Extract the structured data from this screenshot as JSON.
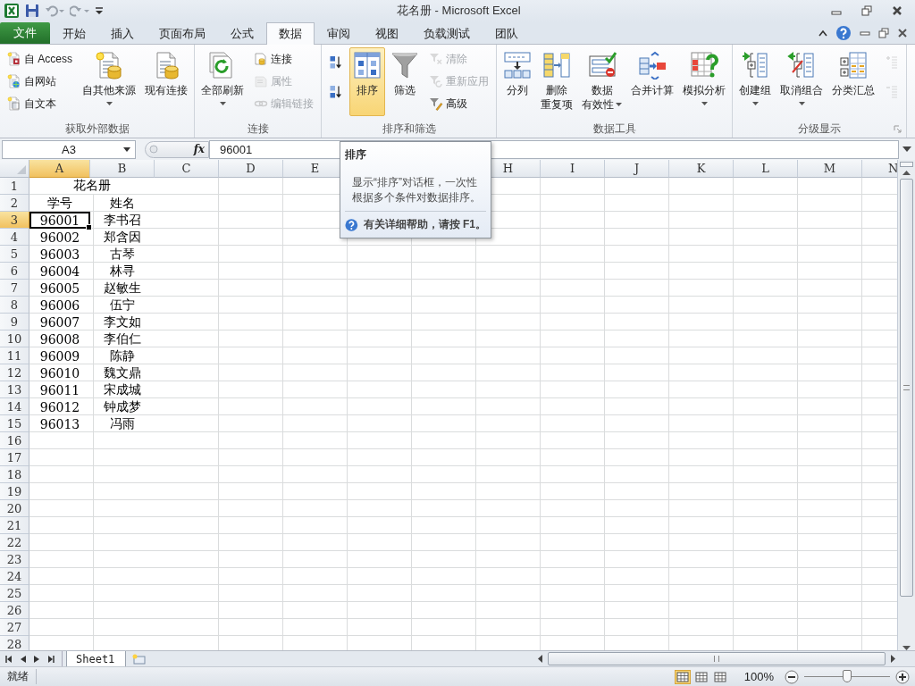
{
  "window": {
    "title": "花名册 - Microsoft Excel"
  },
  "tabs": [
    {
      "label": "文件",
      "kind": "file",
      "selected": false
    },
    {
      "label": "开始",
      "kind": "tab",
      "selected": false
    },
    {
      "label": "插入",
      "kind": "tab",
      "selected": false
    },
    {
      "label": "页面布局",
      "kind": "tab",
      "selected": false
    },
    {
      "label": "公式",
      "kind": "tab",
      "selected": false
    },
    {
      "label": "数据",
      "kind": "tab",
      "selected": true
    },
    {
      "label": "审阅",
      "kind": "tab",
      "selected": false
    },
    {
      "label": "视图",
      "kind": "tab",
      "selected": false
    },
    {
      "label": "负载测试",
      "kind": "tab",
      "selected": false
    },
    {
      "label": "团队",
      "kind": "tab",
      "selected": false
    }
  ],
  "ribbon": {
    "groups": [
      {
        "label": "获取外部数据",
        "columns": [
          {
            "kind": "stack",
            "items": [
              {
                "label": "自 Access",
                "disabled": false
              },
              {
                "label": "自网站",
                "disabled": false
              },
              {
                "label": "自文本",
                "disabled": false
              }
            ]
          },
          {
            "kind": "large",
            "lines": [
              "自其他来源"
            ],
            "dropdown": true,
            "hovered": false
          },
          {
            "kind": "large",
            "lines": [
              "现有连接"
            ],
            "dropdown": false,
            "hovered": false
          }
        ]
      },
      {
        "label": "连接",
        "columns": [
          {
            "kind": "large",
            "lines": [
              "全部刷新"
            ],
            "dropdown": true,
            "hovered": false
          },
          {
            "kind": "stack",
            "items": [
              {
                "label": "连接",
                "disabled": false
              },
              {
                "label": "属性",
                "disabled": true
              },
              {
                "label": "编辑链接",
                "disabled": true
              }
            ]
          }
        ]
      },
      {
        "label": "排序和筛选",
        "columns": [
          {
            "kind": "stack",
            "items": [
              {
                "disabled": false
              },
              {
                "disabled": false
              }
            ]
          },
          {
            "kind": "large",
            "lines": [
              "排序"
            ],
            "dropdown": false,
            "hovered": true
          },
          {
            "kind": "large",
            "lines": [
              "筛选"
            ],
            "dropdown": false,
            "hovered": false
          },
          {
            "kind": "stack",
            "items": [
              {
                "label": "清除",
                "disabled": true
              },
              {
                "label": "重新应用",
                "disabled": true
              },
              {
                "label": "高级",
                "disabled": false
              }
            ]
          }
        ]
      },
      {
        "label": "数据工具",
        "columns": [
          {
            "kind": "large",
            "lines": [
              "分列"
            ],
            "dropdown": false,
            "hovered": false
          },
          {
            "kind": "large",
            "lines": [
              "删除",
              "重复项"
            ],
            "dropdown": false,
            "hovered": false
          },
          {
            "kind": "large",
            "lines": [
              "数据",
              "有效性"
            ],
            "dropdown": true,
            "hovered": false
          },
          {
            "kind": "large",
            "lines": [
              "合并计算"
            ],
            "dropdown": false,
            "hovered": false
          },
          {
            "kind": "large",
            "lines": [
              "模拟分析"
            ],
            "dropdown": true,
            "hovered": false
          }
        ]
      },
      {
        "label": "分级显示",
        "launcher": true,
        "columns": [
          {
            "kind": "large",
            "lines": [
              "创建组"
            ],
            "dropdown": true,
            "hovered": false
          },
          {
            "kind": "large",
            "lines": [
              "取消组合"
            ],
            "dropdown": true,
            "hovered": false
          },
          {
            "kind": "large",
            "lines": [
              "分类汇总"
            ],
            "dropdown": false,
            "hovered": false
          },
          {
            "kind": "stack",
            "items": [
              {
                "disabled": true
              },
              {
                "disabled": true
              }
            ]
          }
        ]
      }
    ]
  },
  "formula_bar": {
    "name_box": "A3",
    "function_label": "fx",
    "value": "96001"
  },
  "tooltip": {
    "title": "排序",
    "body": "显示“排序”对话框，一次性根据多个条件对数据排序。",
    "help": "有关详细帮助，请按 F1。"
  },
  "sheet": {
    "columns": [
      {
        "kind": "header",
        "label": "A"
      },
      {
        "kind": "header",
        "label": "B"
      },
      {
        "kind": "header",
        "label": "C"
      },
      {
        "kind": "header",
        "label": "D"
      },
      {
        "kind": "header",
        "label": "E"
      },
      {
        "kind": "covered"
      },
      {
        "kind": "covered"
      },
      {
        "kind": "header",
        "label": "H"
      },
      {
        "kind": "header",
        "label": "I"
      },
      {
        "kind": "header",
        "label": "J"
      },
      {
        "kind": "header",
        "label": "K"
      },
      {
        "kind": "header",
        "label": "L"
      },
      {
        "kind": "header",
        "label": "M"
      },
      {
        "kind": "header",
        "label": "N"
      }
    ],
    "rows": [
      {
        "header": "1",
        "cells": [
          {
            "kind": "merged",
            "text": "花名册",
            "selected": false
          }
        ]
      },
      {
        "header": "2",
        "cells": [
          {
            "kind": "cell",
            "text": "学号",
            "selected": false
          },
          {
            "kind": "cell",
            "text": "姓名",
            "selected": false
          }
        ]
      },
      {
        "header": "3",
        "cells": [
          {
            "kind": "cell",
            "text": "96001",
            "selected": true
          },
          {
            "kind": "cell",
            "text": "李书召",
            "selected": false
          }
        ]
      },
      {
        "header": "4",
        "cells": [
          {
            "kind": "cell",
            "text": "96002",
            "selected": false
          },
          {
            "kind": "cell",
            "text": "郑含因",
            "selected": false
          }
        ]
      },
      {
        "header": "5",
        "cells": [
          {
            "kind": "cell",
            "text": "96003",
            "selected": false
          },
          {
            "kind": "cell",
            "text": "古琴",
            "selected": false
          }
        ]
      },
      {
        "header": "6",
        "cells": [
          {
            "kind": "cell",
            "text": "96004",
            "selected": false
          },
          {
            "kind": "cell",
            "text": "林寻",
            "selected": false
          }
        ]
      },
      {
        "header": "7",
        "cells": [
          {
            "kind": "cell",
            "text": "96005",
            "selected": false
          },
          {
            "kind": "cell",
            "text": "赵敏生",
            "selected": false
          }
        ]
      },
      {
        "header": "8",
        "cells": [
          {
            "kind": "cell",
            "text": "96006",
            "selected": false
          },
          {
            "kind": "cell",
            "text": "伍宁",
            "selected": false
          }
        ]
      },
      {
        "header": "9",
        "cells": [
          {
            "kind": "cell",
            "text": "96007",
            "selected": false
          },
          {
            "kind": "cell",
            "text": "李文如",
            "selected": false
          }
        ]
      },
      {
        "header": "10",
        "cells": [
          {
            "kind": "cell",
            "text": "96008",
            "selected": false
          },
          {
            "kind": "cell",
            "text": "李伯仁",
            "selected": false
          }
        ]
      },
      {
        "header": "11",
        "cells": [
          {
            "kind": "cell",
            "text": "96009",
            "selected": false
          },
          {
            "kind": "cell",
            "text": "陈静",
            "selected": false
          }
        ]
      },
      {
        "header": "12",
        "cells": [
          {
            "kind": "cell",
            "text": "96010",
            "selected": false
          },
          {
            "kind": "cell",
            "text": "魏文鼎",
            "selected": false
          }
        ]
      },
      {
        "header": "13",
        "cells": [
          {
            "kind": "cell",
            "text": "96011",
            "selected": false
          },
          {
            "kind": "cell",
            "text": "宋成城",
            "selected": false
          }
        ]
      },
      {
        "header": "14",
        "cells": [
          {
            "kind": "cell",
            "text": "96012",
            "selected": false
          },
          {
            "kind": "cell",
            "text": "钟成梦",
            "selected": false
          }
        ]
      },
      {
        "header": "15",
        "cells": [
          {
            "kind": "cell",
            "text": "96013",
            "selected": false
          },
          {
            "kind": "cell",
            "text": "冯雨",
            "selected": false
          }
        ]
      },
      {
        "header": "16"
      },
      {
        "header": "17"
      },
      {
        "header": "18"
      },
      {
        "header": "19"
      },
      {
        "header": "20"
      },
      {
        "header": "21"
      },
      {
        "header": "22"
      },
      {
        "header": "23"
      },
      {
        "header": "24"
      },
      {
        "header": "25"
      },
      {
        "header": "26"
      },
      {
        "header": "27"
      },
      {
        "header": "28"
      }
    ]
  },
  "sheet_tabs": [
    {
      "label": "Sheet1",
      "selected": true
    }
  ],
  "status_bar": {
    "status": "就绪",
    "views": [
      {
        "selected": true
      },
      {
        "selected": false
      },
      {
        "selected": false
      }
    ],
    "zoom": "100%",
    "zoom_slider": {
      "level": 0.5
    }
  }
}
